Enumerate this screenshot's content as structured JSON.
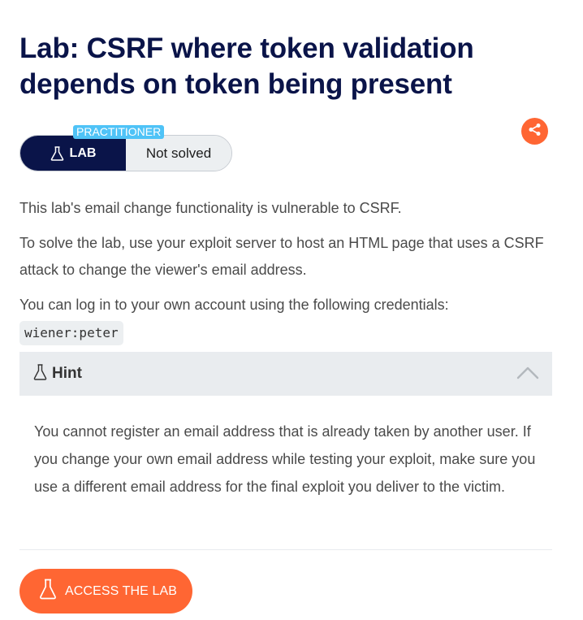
{
  "lab": {
    "title": "Lab: CSRF where token validation depends on token being present",
    "level": "PRACTITIONER",
    "badge_label": "LAB",
    "status": "Not solved"
  },
  "description": {
    "para1": "This lab's email change functionality is vulnerable to CSRF.",
    "para2": "To solve the lab, use your exploit server to host an HTML page that uses a CSRF attack to change the viewer's email address.",
    "para3": "You can log in to your own account using the following credentials:",
    "credentials": "wiener:peter"
  },
  "hint": {
    "label": "Hint",
    "text": "You cannot register an email address that is already taken by another user. If you change your own email address while testing your exploit, make sure you use a different email address for the final exploit you deliver to the victim.",
    "expanded": true
  },
  "actions": {
    "access_label": "ACCESS THE LAB"
  },
  "colors": {
    "title": "#0a1449",
    "accent": "#ff6633",
    "level_tag": "#4fc3f7",
    "badge_dark": "#0a1449"
  },
  "icons": {
    "badge": "flask-icon",
    "share": "share-icon",
    "hint": "flask-icon",
    "collapse": "chevron-up-icon",
    "access": "flask-icon"
  }
}
